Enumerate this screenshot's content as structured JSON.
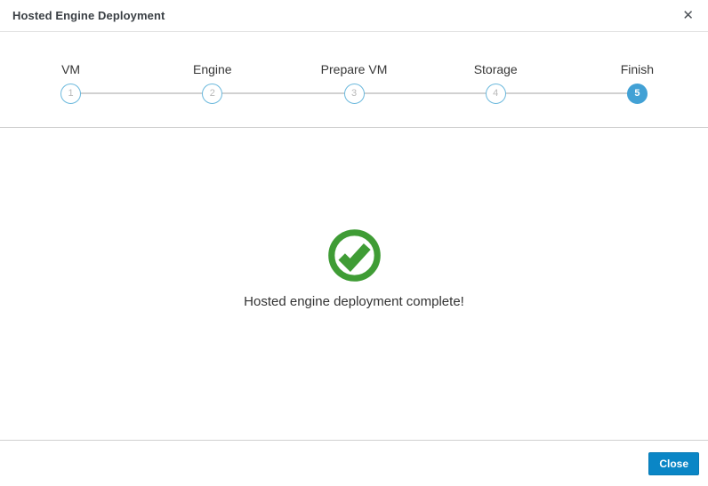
{
  "modal": {
    "title": "Hosted Engine Deployment"
  },
  "icons": {
    "close_glyph": "✕",
    "status_icon": "check-circle-icon"
  },
  "wizard": {
    "steps": [
      {
        "number": "1",
        "label": "VM",
        "active": false
      },
      {
        "number": "2",
        "label": "Engine",
        "active": false
      },
      {
        "number": "3",
        "label": "Prepare VM",
        "active": false
      },
      {
        "number": "4",
        "label": "Storage",
        "active": false
      },
      {
        "number": "5",
        "label": "Finish",
        "active": true
      }
    ]
  },
  "content": {
    "message": "Hosted engine deployment complete!"
  },
  "footer": {
    "close_label": "Close"
  },
  "colors": {
    "success_green": "#3f9c35",
    "primary_button_blue": "#0a86c6",
    "active_step_blue": "#42a1d5",
    "step_border_blue": "#6cb9dd",
    "connector_gray": "#d1d1d1"
  }
}
